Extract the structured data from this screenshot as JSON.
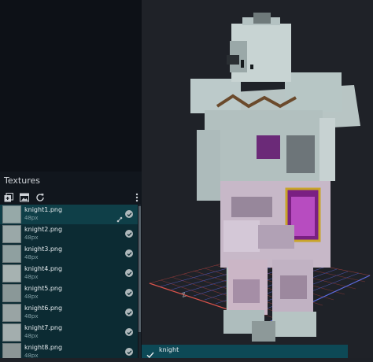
{
  "textures_panel": {
    "title": "Textures",
    "toolbar": [
      "add-texture-icon",
      "import-image-icon",
      "refresh-icon",
      "more-vert-icon"
    ],
    "items": [
      {
        "name": "knight1.png",
        "size": "48px",
        "selected": true
      },
      {
        "name": "knight2.png",
        "size": "48px",
        "selected": false
      },
      {
        "name": "knight3.png",
        "size": "48px",
        "selected": false
      },
      {
        "name": "knight4.png",
        "size": "48px",
        "selected": false
      },
      {
        "name": "knight5.png",
        "size": "48px",
        "selected": false
      },
      {
        "name": "knight6.png",
        "size": "48px",
        "selected": false
      },
      {
        "name": "knight7.png",
        "size": "48px",
        "selected": false
      },
      {
        "name": "knight8.png",
        "size": "48px",
        "selected": false
      }
    ]
  },
  "viewport": {
    "model": "knight"
  },
  "status": {
    "label": "knight"
  },
  "colors": {
    "accent_teal": "#0f3f48",
    "status_bar": "#0d4956",
    "grid_red": "#d8534b",
    "grid_blue": "#5b6be0",
    "armor_silver": "#b7c7c6",
    "purple_cloth": "#7a1f82",
    "gold_trim": "#c8a429"
  }
}
